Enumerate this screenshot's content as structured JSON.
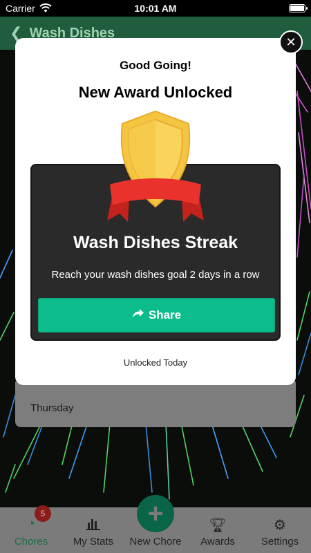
{
  "status": {
    "carrier": "Carrier",
    "time": "10:01 AM"
  },
  "header": {
    "title": "Wash Dishes",
    "back_icon": "chevron-left-icon"
  },
  "background": {
    "day_label": "Thursday"
  },
  "modal": {
    "subtitle": "Good Going!",
    "title": "New Award Unlocked",
    "award_name": "Wash Dishes Streak",
    "award_description": "Reach your wash dishes goal 2 days in a row",
    "share_label": "Share",
    "unlocked_text": "Unlocked Today",
    "close_icon": "close-icon"
  },
  "tabs": [
    {
      "label": "Chores",
      "icon": "clock-icon",
      "badge": "5",
      "active": true
    },
    {
      "label": "My Stats",
      "icon": "bar-chart-icon"
    },
    {
      "label": "New Chore",
      "icon": "plus-icon"
    },
    {
      "label": "Awards",
      "icon": "trophy-icon"
    },
    {
      "label": "Settings",
      "icon": "gear-icon"
    }
  ],
  "colors": {
    "accent": "#0cbc8a",
    "header_bg": "#1f5d3c",
    "shield_gold": "#f5c542",
    "ribbon_red": "#e8322b"
  }
}
